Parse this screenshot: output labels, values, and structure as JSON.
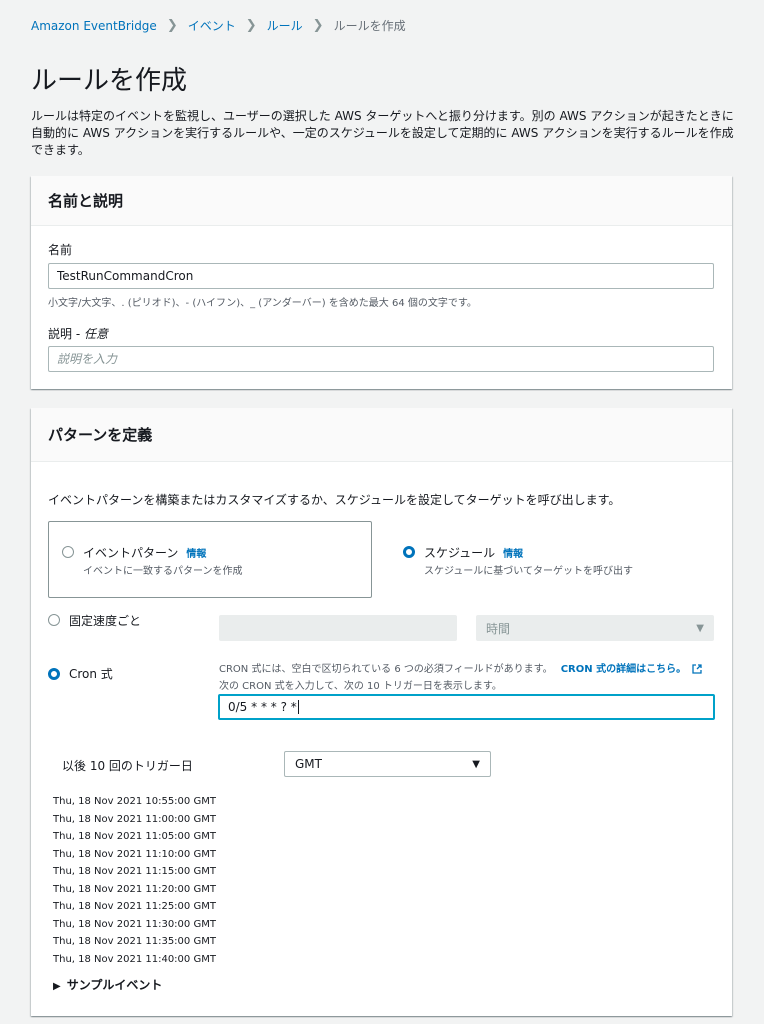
{
  "breadcrumb": {
    "items": [
      "Amazon EventBridge",
      "イベント",
      "ルール"
    ],
    "current": "ルールを作成"
  },
  "page": {
    "title": "ルールを作成",
    "description": "ルールは特定のイベントを監視し、ユーザーの選択した AWS ターゲットへと振り分けます。別の AWS アクションが起きたときに自動的に AWS アクションを実行するルールや、一定のスケジュールを設定して定期的に AWS アクションを実行するルールを作成できます。"
  },
  "name_panel": {
    "header": "名前と説明",
    "name_label": "名前",
    "name_value": "TestRunCommandCron",
    "name_hint": "小文字/大文字、. (ピリオド)、- (ハイフン)、_ (アンダーバー) を含めた最大 64 個の文字です。",
    "desc_label": "説明 - ",
    "desc_optional": "任意",
    "desc_placeholder": "説明を入力"
  },
  "pattern_panel": {
    "header": "パターンを定義",
    "intro": "イベントパターンを構築またはカスタマイズするか、スケジュールを設定してターゲットを呼び出します。",
    "event_pattern": {
      "title": "イベントパターン",
      "info": "情報",
      "sub": "イベントに一致するパターンを作成",
      "selected": false
    },
    "schedule": {
      "title": "スケジュール",
      "info": "情報",
      "sub": "スケジュールに基づいてターゲットを呼び出す",
      "selected": true
    },
    "fixed_rate": {
      "label": "固定速度ごと",
      "unit": "時間",
      "selected": false
    },
    "cron": {
      "label": "Cron 式",
      "selected": true,
      "help_line1": "CRON 式には、空白で区切られている 6 つの必須フィールドがあります。",
      "help_link": "CRON 式の詳細はこちら。",
      "help_line2": "次の CRON 式を入力して、次の 10 トリガー日を表示します。",
      "value": "0/5 * * * ? *"
    },
    "next_triggers": {
      "label": "以後 10 回のトリガー日",
      "timezone": "GMT",
      "dates": [
        "Thu, 18 Nov 2021 10:55:00 GMT",
        "Thu, 18 Nov 2021 11:00:00 GMT",
        "Thu, 18 Nov 2021 11:05:00 GMT",
        "Thu, 18 Nov 2021 11:10:00 GMT",
        "Thu, 18 Nov 2021 11:15:00 GMT",
        "Thu, 18 Nov 2021 11:20:00 GMT",
        "Thu, 18 Nov 2021 11:25:00 GMT",
        "Thu, 18 Nov 2021 11:30:00 GMT",
        "Thu, 18 Nov 2021 11:35:00 GMT",
        "Thu, 18 Nov 2021 11:40:00 GMT"
      ]
    },
    "sample_event": "サンプルイベント"
  },
  "colors": {
    "link": "#0073bb",
    "focus": "#00a1c9",
    "background": "#f2f3f3"
  }
}
